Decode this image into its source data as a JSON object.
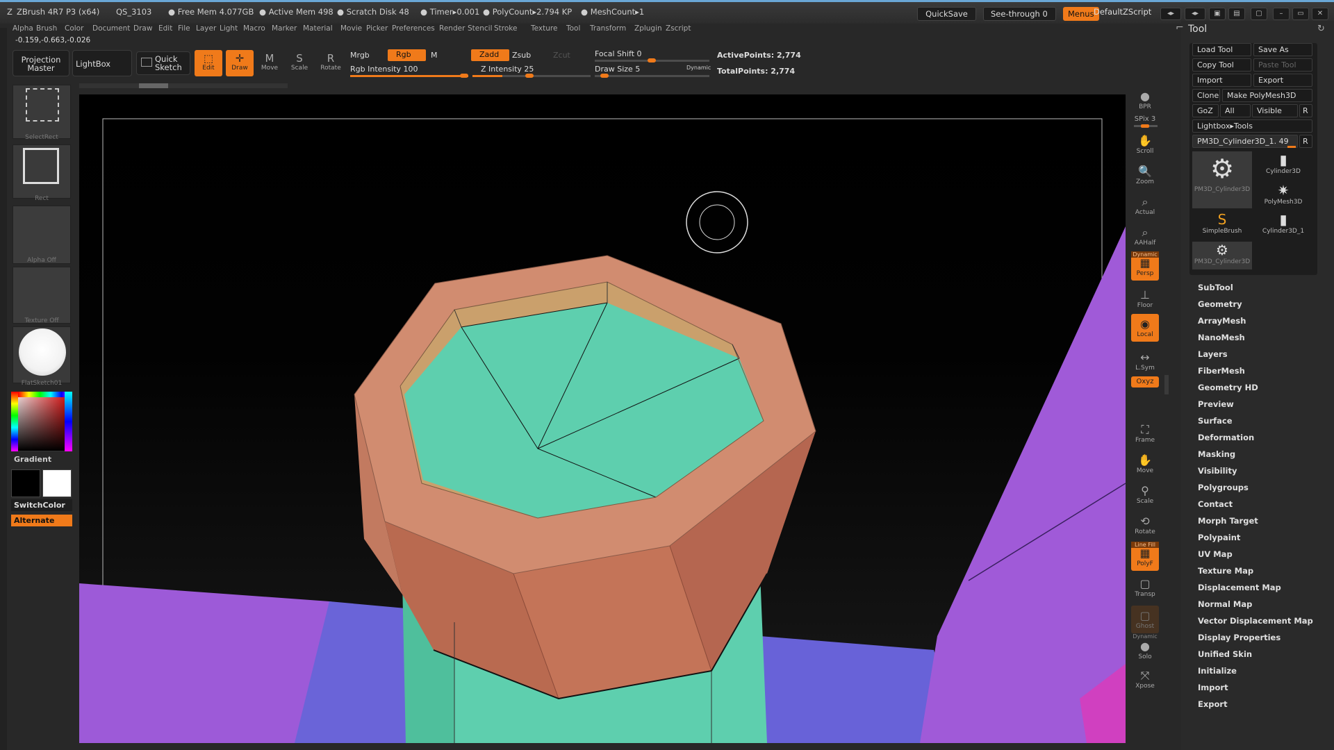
{
  "titlebar": {
    "app": "ZBrush 4R7 P3 (x64)",
    "session": "QS_3103",
    "free_mem": "● Free Mem 4.077GB",
    "active_mem": "● Active Mem 498",
    "scratch": "● Scratch Disk 48",
    "timer": "● Timer▸0.001",
    "polycount": "● PolyCount▸2.794 KP",
    "meshcount": "● MeshCount▸1",
    "quicksave": "QuickSave",
    "see_through": "See-through",
    "see_through_value": "0",
    "menus": "Menus",
    "script": "DefaultZScript"
  },
  "menubar": [
    "Alpha",
    "Brush",
    "Color",
    "Document",
    "Draw",
    "Edit",
    "File",
    "Layer",
    "Light",
    "Macro",
    "Marker",
    "Material",
    "Movie",
    "Picker",
    "Preferences",
    "Render",
    "Stencil",
    "Stroke",
    "Texture",
    "Tool",
    "Transform",
    "Zplugin",
    "Zscript"
  ],
  "coords": "-0.159,-0.663,-0.026",
  "toolbar": {
    "projection_master": "Projection\nMaster",
    "lightbox": "LightBox",
    "quick_sketch": "Quick\nSketch",
    "edit": "Edit",
    "draw": "Draw",
    "move": "Move",
    "scale": "Scale",
    "rotate": "Rotate",
    "mrgb": "Mrgb",
    "rgb": "Rgb",
    "m": "M",
    "rgb_intensity_label": "Rgb Intensity",
    "rgb_intensity": "100",
    "zadd": "Zadd",
    "zsub": "Zsub",
    "zcut": "Zcut",
    "z_intensity_label": "Z Intensity",
    "z_intensity": "25",
    "focal_shift_label": "Focal Shift",
    "focal_shift": "0",
    "draw_size_label": "Draw Size",
    "draw_size": "5",
    "dynamic": "Dynamic",
    "active_points": "ActivePoints: 2,774",
    "total_points": "TotalPoints: 2,774"
  },
  "left_shelf": {
    "select_rect": "SelectRect",
    "rect": "Rect",
    "alpha_off": "Alpha  Off",
    "texture_off": "Texture  Off",
    "material": "FlatSketch01",
    "gradient": "Gradient",
    "switch_color": "SwitchColor",
    "alternate": "Alternate"
  },
  "right_shelf": [
    "BPR",
    "SPix 3",
    "Scroll",
    "Zoom",
    "Actual",
    "AAHalf",
    "Persp",
    "Floor",
    "Local",
    "L.Sym",
    "Oxyz",
    "Frame",
    "Move",
    "Scale",
    "Rotate",
    "PolyF",
    "Transp",
    "Ghost",
    "Solo",
    "Xpose"
  ],
  "right_shelf_extra": {
    "dynamic_top": "Dynamic",
    "dynamic_solo": "Dynamic",
    "line_fill": "Line Fill"
  },
  "tool_panel": {
    "title": "Tool",
    "load_tool": "Load Tool",
    "save_as": "Save As",
    "copy_tool": "Copy Tool",
    "paste_tool": "Paste Tool",
    "import": "Import",
    "export": "Export",
    "clone": "Clone",
    "make_polymesh": "Make PolyMesh3D",
    "goz": "GoZ",
    "all": "All",
    "visible": "Visible",
    "r": "R",
    "lightbox_tools": "Lightbox▸Tools",
    "current_tool": "PM3D_Cylinder3D_1. 49",
    "thumbs": [
      "PM3D_Cylinder3D",
      "Cylinder3D",
      "PolyMesh3D",
      "SimpleBrush",
      "Cylinder3D_1",
      "PM3D_Cylinder3D"
    ],
    "menu": [
      "SubTool",
      "Geometry",
      "ArrayMesh",
      "NanoMesh",
      "Layers",
      "FiberMesh",
      "Geometry HD",
      "Preview",
      "Surface",
      "Deformation",
      "Masking",
      "Visibility",
      "Polygroups",
      "Contact",
      "Morph Target",
      "Polypaint",
      "UV Map",
      "Texture Map",
      "Displacement Map",
      "Normal Map",
      "Vector Displacement Map",
      "Display Properties",
      "Unified Skin",
      "Initialize",
      "Import",
      "Export"
    ]
  },
  "colors": {
    "accent": "#f07a1a",
    "mesh_green": "#5ecfae",
    "mesh_salmon": "#d18c70",
    "floor_purple": "#9a5ad8",
    "floor_blue": "#6a64d8"
  }
}
